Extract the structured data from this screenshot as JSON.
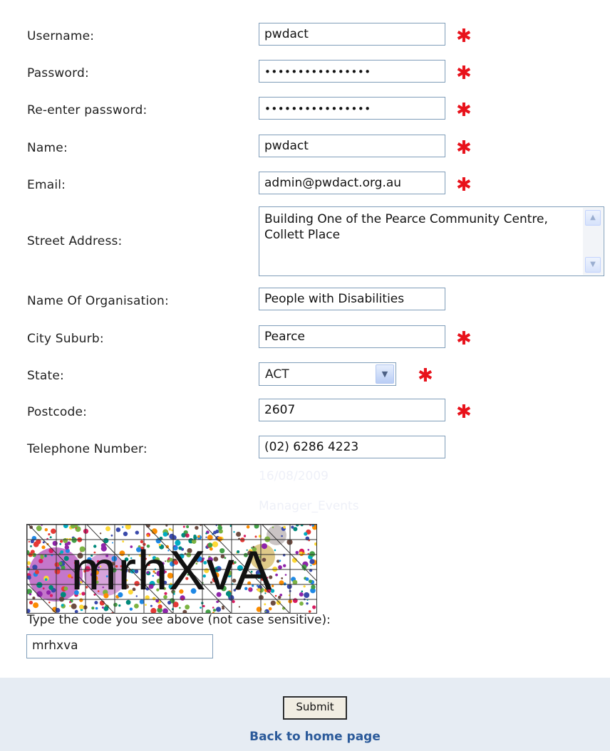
{
  "form": {
    "username": {
      "label": "Username:",
      "value": "pwdact",
      "required": true
    },
    "password": {
      "label": "Password:",
      "value": "••••••••••••••••",
      "required": true
    },
    "reenter_password": {
      "label": "Re-enter password:",
      "value": "••••••••••••••••",
      "required": true
    },
    "name": {
      "label": "Name:",
      "value": "pwdact",
      "required": true
    },
    "email": {
      "label": "Email:",
      "value": "admin@pwdact.org.au",
      "required": true
    },
    "street_address": {
      "label": "Street Address:",
      "value": "Building One of the Pearce Community Centre, Collett Place"
    },
    "organisation": {
      "label": "Name Of Organisation:",
      "value": "People with Disabilities"
    },
    "city_suburb": {
      "label": "City Suburb:",
      "value": "Pearce",
      "required": true
    },
    "state": {
      "label": "State:",
      "value": "ACT",
      "required": true
    },
    "postcode": {
      "label": "Postcode:",
      "value": "2607",
      "required": true
    },
    "telephone": {
      "label": "Telephone Number:",
      "value": "(02) 6286 4223"
    },
    "required_marker": "✱"
  },
  "hidden_info": {
    "date": "16/08/2009",
    "role": "Manager_Events"
  },
  "captcha": {
    "code_image_text": "mrhXvA",
    "instruction": "Type the code you see above (not case sensitive):",
    "input_value": "mrhxva"
  },
  "footer": {
    "submit_label": "Submit",
    "back_link": "Back to home page"
  },
  "colors": {
    "required": "#e8121b",
    "footer_bg": "#e6ecf3",
    "link": "#2b5a9a",
    "field_border": "#7f9db9"
  }
}
